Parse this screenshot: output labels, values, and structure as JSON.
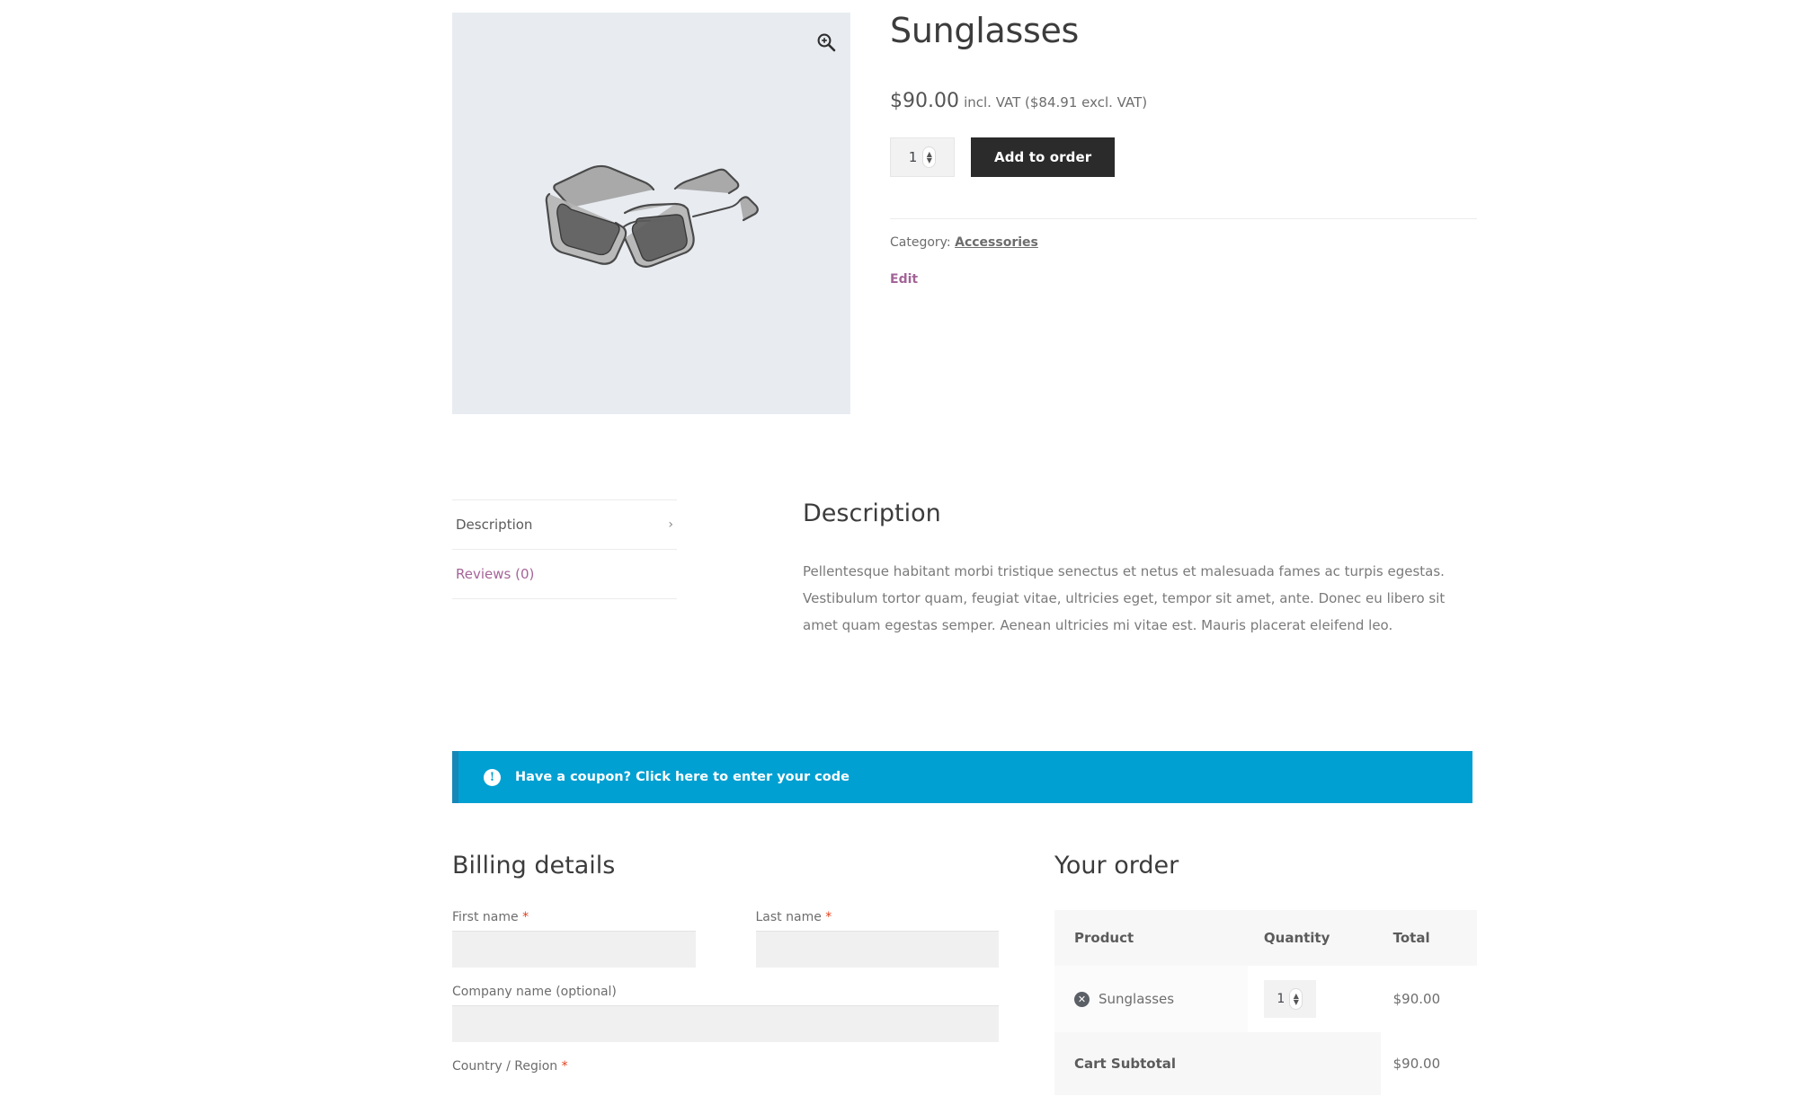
{
  "product": {
    "title": "Sunglasses",
    "price_main": "$90.00",
    "price_suffix": "incl. VAT ($84.91 excl. VAT)",
    "quantity": "1",
    "add_to_cart_label": "Add to order",
    "category_label": "Category:",
    "category_value": "Accessories",
    "edit_label": "Edit",
    "zoom_icon": "magnifier-plus-icon",
    "image_alt": "sunglasses-illustration",
    "image_background": "#e8ecf1"
  },
  "tabs": {
    "items": [
      {
        "label": "Description",
        "active": true
      },
      {
        "label": "Reviews (0)",
        "active": false
      }
    ],
    "panel_title": "Description",
    "panel_body": "Pellentesque habitant morbi tristique senectus et netus et malesuada fames ac turpis egestas. Vestibulum tortor quam, feugiat vitae, ultricies eget, tempor sit amet, ante. Donec eu libero sit amet quam egestas semper. Aenean ultricies mi vitae est. Mauris placerat eleifend leo."
  },
  "coupon": {
    "text": "Have a coupon? Click here to enter your code",
    "icon": "info-icon",
    "background": "#00a0d2",
    "border": "#1787b8"
  },
  "billing": {
    "title": "Billing details",
    "fields": [
      {
        "label": "First name",
        "required": true,
        "value": "",
        "placeholder": ""
      },
      {
        "label": "Last name",
        "required": true,
        "value": "",
        "placeholder": ""
      },
      {
        "label": "Company name (optional)",
        "required": false,
        "value": "",
        "placeholder": ""
      },
      {
        "label": "Country / Region",
        "required": true,
        "value": "",
        "placeholder": ""
      }
    ],
    "required_marker": "*"
  },
  "order": {
    "title": "Your order",
    "headers": [
      "Product",
      "Quantity",
      "Total"
    ],
    "rows": [
      {
        "product": "Sunglasses",
        "quantity": "1",
        "total": "$90.00",
        "remove_icon": "remove-item-icon"
      }
    ],
    "subtotal_label": "Cart Subtotal",
    "subtotal_value": "$90.00"
  },
  "theme": {
    "accent_link": "#a46497",
    "required_red": "#e2401c",
    "button_dark": "#2b2b2b",
    "info_blue": "#00a0d2"
  }
}
